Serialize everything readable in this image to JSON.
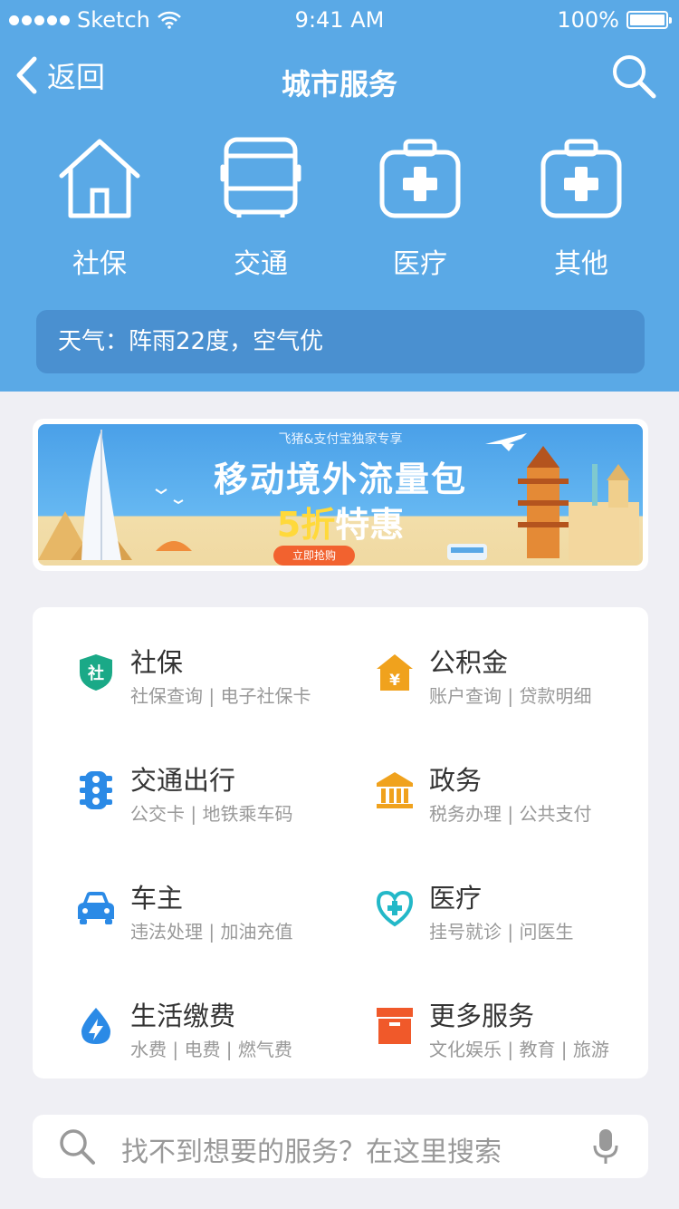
{
  "status_bar": {
    "carrier": "Sketch",
    "time": "9:41 AM",
    "battery": "100%"
  },
  "nav": {
    "back_label": "返回",
    "title": "城市服务",
    "back_icon": "chevron-left-icon",
    "search_icon": "search-icon"
  },
  "quick_entries": [
    {
      "label": "社保",
      "icon": "house-icon"
    },
    {
      "label": "交通",
      "icon": "bus-icon"
    },
    {
      "label": "医疗",
      "icon": "medical-kit-icon"
    },
    {
      "label": "其他",
      "icon": "medical-kit-icon"
    }
  ],
  "weather": {
    "text": "天气：阵雨22度，空气优"
  },
  "banner": {
    "tag": "飞猪&支付宝独家专享",
    "title": "移动境外流量包",
    "highlight": "5折",
    "subtitle_rest": "特惠",
    "button": "立即抢购"
  },
  "services": [
    {
      "name": "社保",
      "sub": "社保查询 | 电子社保卡",
      "icon": "shield-icon",
      "color": "#1aa987"
    },
    {
      "name": "公积金",
      "sub": "账户查询 | 贷款明细",
      "icon": "house-yuan-icon",
      "color": "#f0a21d"
    },
    {
      "name": "交通出行",
      "sub": "公交卡 | 地铁乘车码",
      "icon": "traffic-light-icon",
      "color": "#2b8ae6"
    },
    {
      "name": "政务",
      "sub": "税务办理 | 公共支付",
      "icon": "government-icon",
      "color": "#f0a21d"
    },
    {
      "name": "车主",
      "sub": "违法处理 | 加油充值",
      "icon": "car-icon",
      "color": "#2b8ae6"
    },
    {
      "name": "医疗",
      "sub": "挂号就诊 | 问医生",
      "icon": "heart-cross-icon",
      "color": "#23b8c8"
    },
    {
      "name": "生活缴费",
      "sub": "水费 | 电费 | 燃气费",
      "icon": "water-drop-icon",
      "color": "#2b8ae6"
    },
    {
      "name": "更多服务",
      "sub": "文化娱乐 | 教育 | 旅游",
      "icon": "box-icon",
      "color": "#f0592a"
    }
  ],
  "bottom_search": {
    "placeholder": "找不到想要的服务？在这里搜索",
    "search_icon": "search-icon",
    "mic_icon": "microphone-icon"
  },
  "colors": {
    "header_bg": "#5aa9e6",
    "weather_bg": "#4a90d0",
    "page_bg": "#efeff4"
  }
}
